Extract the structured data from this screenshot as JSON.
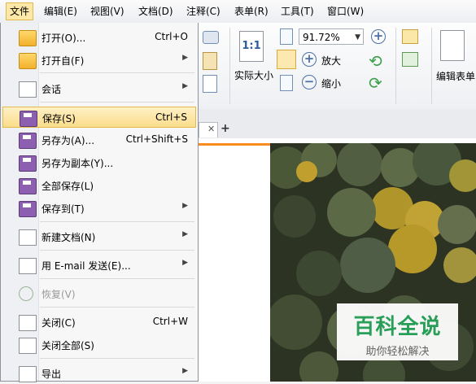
{
  "menubar": {
    "items": [
      {
        "label": "文件",
        "active": true
      },
      {
        "label": "编辑(E)"
      },
      {
        "label": "视图(V)"
      },
      {
        "label": "文档(D)"
      },
      {
        "label": "注释(C)"
      },
      {
        "label": "表单(R)"
      },
      {
        "label": "工具(T)"
      },
      {
        "label": "窗口(W)"
      }
    ]
  },
  "file_menu": {
    "items": [
      {
        "label": "打开(O)...",
        "shortcut": "Ctrl+O",
        "icon": "folder-open-icon"
      },
      {
        "label": "打开自(F)",
        "submenu": "▶",
        "icon": "folder-globe-icon"
      },
      {
        "label": "会话",
        "submenu": "▶",
        "icon": "session-icon"
      },
      {
        "label": "保存(S)",
        "shortcut": "Ctrl+S",
        "icon": "save-disk-icon"
      },
      {
        "label": "另存为(A)...",
        "shortcut": "Ctrl+Shift+S",
        "icon": "save-as-icon"
      },
      {
        "label": "另存为副本(Y)...",
        "icon": "save-copy-icon"
      },
      {
        "label": "全部保存(L)",
        "icon": "save-all-icon"
      },
      {
        "label": "保存到(T)",
        "submenu": "▶",
        "icon": "save-to-icon"
      },
      {
        "label": "新建文档(N)",
        "submenu": "▶",
        "icon": "new-document-icon"
      },
      {
        "label": "用 E-mail 发送(E)...",
        "submenu": "▶",
        "icon": "email-icon"
      },
      {
        "label": "恢复(V)",
        "icon": "restore-icon"
      },
      {
        "label": "关闭(C)",
        "shortcut": "Ctrl+W",
        "icon": "close-document-icon"
      },
      {
        "label": "关闭全部(S)",
        "icon": "close-all-icon"
      },
      {
        "label": "导出",
        "submenu": "▶",
        "icon": "export-icon"
      }
    ]
  },
  "ribbon": {
    "actual_size_label": "实际大小",
    "actual_size_icon_text": "1:1",
    "zoom_value": "91.72%",
    "zoom_in_label": "放大",
    "zoom_out_label": "缩小",
    "edit_form_label": "编辑表单",
    "dropdown_arrow": "▼"
  },
  "tabs": {
    "close_glyph": "✕",
    "add_glyph": "+"
  },
  "watermark": {
    "title": "百科全说",
    "subtitle": "助你轻松解决"
  },
  "colors": {
    "highlight": "#fbdc8a",
    "watermark_green": "#27a35b",
    "tab_accent": "#fa8a1e"
  }
}
